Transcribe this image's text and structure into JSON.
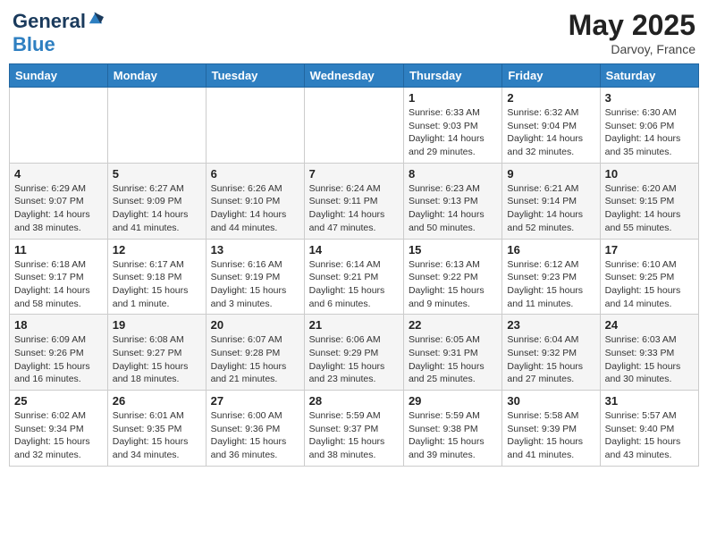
{
  "header": {
    "logo_line1": "General",
    "logo_line2": "Blue",
    "main_title": "May 2025",
    "subtitle": "Darvoy, France"
  },
  "calendar": {
    "days_of_week": [
      "Sunday",
      "Monday",
      "Tuesday",
      "Wednesday",
      "Thursday",
      "Friday",
      "Saturday"
    ],
    "weeks": [
      [
        {
          "day": "",
          "info": ""
        },
        {
          "day": "",
          "info": ""
        },
        {
          "day": "",
          "info": ""
        },
        {
          "day": "",
          "info": ""
        },
        {
          "day": "1",
          "info": "Sunrise: 6:33 AM\nSunset: 9:03 PM\nDaylight: 14 hours and 29 minutes."
        },
        {
          "day": "2",
          "info": "Sunrise: 6:32 AM\nSunset: 9:04 PM\nDaylight: 14 hours and 32 minutes."
        },
        {
          "day": "3",
          "info": "Sunrise: 6:30 AM\nSunset: 9:06 PM\nDaylight: 14 hours and 35 minutes."
        }
      ],
      [
        {
          "day": "4",
          "info": "Sunrise: 6:29 AM\nSunset: 9:07 PM\nDaylight: 14 hours and 38 minutes."
        },
        {
          "day": "5",
          "info": "Sunrise: 6:27 AM\nSunset: 9:09 PM\nDaylight: 14 hours and 41 minutes."
        },
        {
          "day": "6",
          "info": "Sunrise: 6:26 AM\nSunset: 9:10 PM\nDaylight: 14 hours and 44 minutes."
        },
        {
          "day": "7",
          "info": "Sunrise: 6:24 AM\nSunset: 9:11 PM\nDaylight: 14 hours and 47 minutes."
        },
        {
          "day": "8",
          "info": "Sunrise: 6:23 AM\nSunset: 9:13 PM\nDaylight: 14 hours and 50 minutes."
        },
        {
          "day": "9",
          "info": "Sunrise: 6:21 AM\nSunset: 9:14 PM\nDaylight: 14 hours and 52 minutes."
        },
        {
          "day": "10",
          "info": "Sunrise: 6:20 AM\nSunset: 9:15 PM\nDaylight: 14 hours and 55 minutes."
        }
      ],
      [
        {
          "day": "11",
          "info": "Sunrise: 6:18 AM\nSunset: 9:17 PM\nDaylight: 14 hours and 58 minutes."
        },
        {
          "day": "12",
          "info": "Sunrise: 6:17 AM\nSunset: 9:18 PM\nDaylight: 15 hours and 1 minute."
        },
        {
          "day": "13",
          "info": "Sunrise: 6:16 AM\nSunset: 9:19 PM\nDaylight: 15 hours and 3 minutes."
        },
        {
          "day": "14",
          "info": "Sunrise: 6:14 AM\nSunset: 9:21 PM\nDaylight: 15 hours and 6 minutes."
        },
        {
          "day": "15",
          "info": "Sunrise: 6:13 AM\nSunset: 9:22 PM\nDaylight: 15 hours and 9 minutes."
        },
        {
          "day": "16",
          "info": "Sunrise: 6:12 AM\nSunset: 9:23 PM\nDaylight: 15 hours and 11 minutes."
        },
        {
          "day": "17",
          "info": "Sunrise: 6:10 AM\nSunset: 9:25 PM\nDaylight: 15 hours and 14 minutes."
        }
      ],
      [
        {
          "day": "18",
          "info": "Sunrise: 6:09 AM\nSunset: 9:26 PM\nDaylight: 15 hours and 16 minutes."
        },
        {
          "day": "19",
          "info": "Sunrise: 6:08 AM\nSunset: 9:27 PM\nDaylight: 15 hours and 18 minutes."
        },
        {
          "day": "20",
          "info": "Sunrise: 6:07 AM\nSunset: 9:28 PM\nDaylight: 15 hours and 21 minutes."
        },
        {
          "day": "21",
          "info": "Sunrise: 6:06 AM\nSunset: 9:29 PM\nDaylight: 15 hours and 23 minutes."
        },
        {
          "day": "22",
          "info": "Sunrise: 6:05 AM\nSunset: 9:31 PM\nDaylight: 15 hours and 25 minutes."
        },
        {
          "day": "23",
          "info": "Sunrise: 6:04 AM\nSunset: 9:32 PM\nDaylight: 15 hours and 27 minutes."
        },
        {
          "day": "24",
          "info": "Sunrise: 6:03 AM\nSunset: 9:33 PM\nDaylight: 15 hours and 30 minutes."
        }
      ],
      [
        {
          "day": "25",
          "info": "Sunrise: 6:02 AM\nSunset: 9:34 PM\nDaylight: 15 hours and 32 minutes."
        },
        {
          "day": "26",
          "info": "Sunrise: 6:01 AM\nSunset: 9:35 PM\nDaylight: 15 hours and 34 minutes."
        },
        {
          "day": "27",
          "info": "Sunrise: 6:00 AM\nSunset: 9:36 PM\nDaylight: 15 hours and 36 minutes."
        },
        {
          "day": "28",
          "info": "Sunrise: 5:59 AM\nSunset: 9:37 PM\nDaylight: 15 hours and 38 minutes."
        },
        {
          "day": "29",
          "info": "Sunrise: 5:59 AM\nSunset: 9:38 PM\nDaylight: 15 hours and 39 minutes."
        },
        {
          "day": "30",
          "info": "Sunrise: 5:58 AM\nSunset: 9:39 PM\nDaylight: 15 hours and 41 minutes."
        },
        {
          "day": "31",
          "info": "Sunrise: 5:57 AM\nSunset: 9:40 PM\nDaylight: 15 hours and 43 minutes."
        }
      ]
    ]
  }
}
